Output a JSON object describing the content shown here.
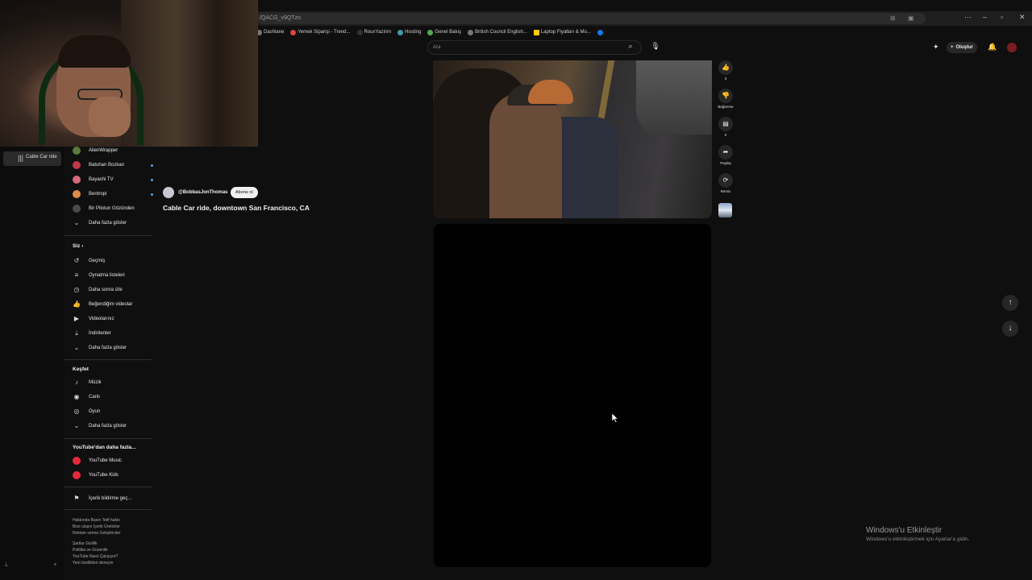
{
  "browser": {
    "url": "/QACG_v9QTzo",
    "bookmarks": [
      {
        "label": "Dashlane"
      },
      {
        "label": "Yemek Siparişi - Trend..."
      },
      {
        "label": "RouxYazılım"
      },
      {
        "label": "Hosting"
      },
      {
        "label": "Genel Bakış"
      },
      {
        "label": "British Council English..."
      },
      {
        "label": "Laptop Fiyatları & Mo..."
      }
    ]
  },
  "mini_sidebar": {
    "active_item": "Cable Car ride"
  },
  "sidebar": {
    "subscriptions": [
      {
        "label": "AlienWrapper",
        "color": "#5a7a3a",
        "live": false
      },
      {
        "label": "Batuhan Bozkan",
        "color": "#c0394a",
        "live": true
      },
      {
        "label": "Bayashi TV",
        "color": "#d46a7a",
        "live": true
      },
      {
        "label": "Bentropi",
        "color": "#e08a4a",
        "live": true
      },
      {
        "label": "Bir Pilotun Gözünden",
        "color": "#4a4a4a",
        "live": false
      }
    ],
    "show_more_1": "Daha fazla göster",
    "you_header": "Siz",
    "you_items": [
      {
        "label": "Geçmiş",
        "icon": "history-icon"
      },
      {
        "label": "Oynatma listeleri",
        "icon": "playlist-icon"
      },
      {
        "label": "Daha sonra izle",
        "icon": "clock-icon"
      },
      {
        "label": "Beğendiğim videolar",
        "icon": "thumb-up-icon"
      },
      {
        "label": "Videolarınız",
        "icon": "video-icon"
      },
      {
        "label": "İndirilenler",
        "icon": "download-icon"
      }
    ],
    "show_more_2": "Daha fazla göster",
    "explore_header": "Keşfet",
    "explore_items": [
      {
        "label": "Müzik",
        "icon": "music-icon"
      },
      {
        "label": "Canlı",
        "icon": "live-icon"
      },
      {
        "label": "Oyun",
        "icon": "gamepad-icon"
      }
    ],
    "show_more_3": "Daha fazla göster",
    "more_header": "YouTube'dan daha fazla...",
    "more_items": [
      {
        "label": "YouTube Music"
      },
      {
        "label": "YouTube Kids"
      }
    ],
    "report_item": "İçerik bildirme geç...",
    "footer_1": "Hakkında  Basın  Telif hakkı",
    "footer_2": "Bize ulaşın  İçerik Üreticiler",
    "footer_3": "Reklam verme  Geliştiriciler",
    "footer_4": "Şartlar  Gizlilik",
    "footer_5": "Politika ve Güvenlik",
    "footer_6": "YouTube Nasıl Çalışıyor?",
    "footer_7": "Yeni özellikleri deneyin"
  },
  "topbar": {
    "search_placeholder": "Ara",
    "create_label": "Oluştur"
  },
  "short": {
    "channel": "@BobbasJonThomas",
    "subscribe_label": "Abone ol",
    "title": "Cable Car ride, downtown San Francisco, CA",
    "like_count": "3",
    "dislike_label": "Beğenme",
    "comment_count": "0",
    "share_label": "Paylaş",
    "remix_label": "Remix"
  },
  "windows_notice": {
    "heading": "Windows'u Etkinleştir",
    "sub": "Windows'u etkinleştirmek için Ayarlar'a gidin."
  }
}
